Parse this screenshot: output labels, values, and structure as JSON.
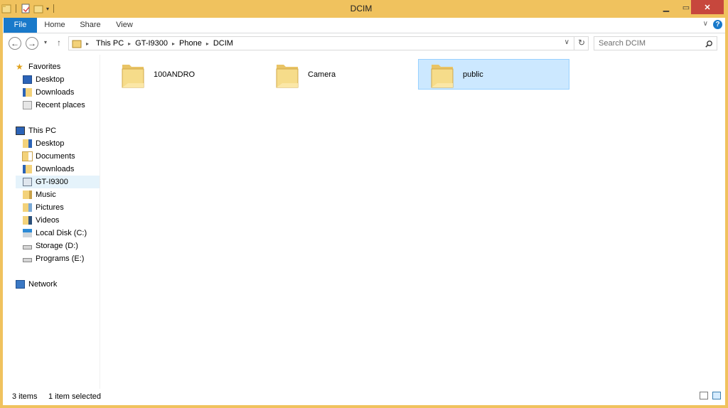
{
  "window": {
    "title": "DCIM"
  },
  "ribbon": {
    "tabs": [
      "File",
      "Home",
      "Share",
      "View"
    ],
    "help": "?"
  },
  "address": {
    "crumbs": [
      "This PC",
      "GT-I9300",
      "Phone",
      "DCIM"
    ]
  },
  "search": {
    "placeholder": "Search DCIM"
  },
  "nav": {
    "favorites": {
      "label": "Favorites",
      "items": [
        "Desktop",
        "Downloads",
        "Recent places"
      ]
    },
    "thispc": {
      "label": "This PC",
      "items": [
        "Desktop",
        "Documents",
        "Downloads",
        "GT-I9300",
        "Music",
        "Pictures",
        "Videos",
        "Local Disk (C:)",
        "Storage (D:)",
        "Programs (E:)"
      ]
    },
    "network": {
      "label": "Network"
    },
    "selected": "GT-I9300"
  },
  "folders": [
    {
      "name": "100ANDRO",
      "selected": false
    },
    {
      "name": "Camera",
      "selected": false
    },
    {
      "name": "public",
      "selected": true
    }
  ],
  "status": {
    "items": "3 items",
    "selected": "1 item selected"
  },
  "colors": {
    "frame": "#f0c25e",
    "file_tab": "#1979ca",
    "close": "#c7473d",
    "selection": "#cce8ff",
    "selection_border": "#99d1ff",
    "folder": "#f3d27a"
  }
}
